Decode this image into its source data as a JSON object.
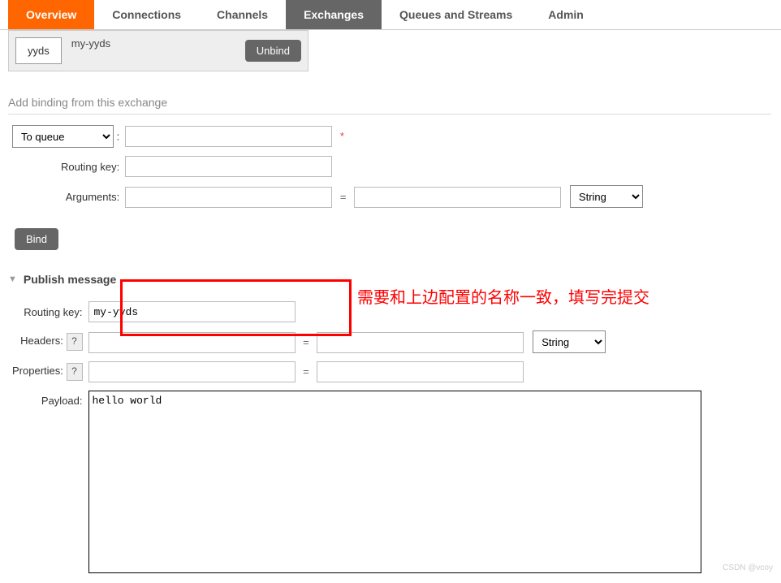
{
  "tabs": {
    "overview": "Overview",
    "connections": "Connections",
    "channels": "Channels",
    "exchanges": "Exchanges",
    "queues": "Queues and Streams",
    "admin": "Admin"
  },
  "binding": {
    "key": "yyds",
    "name": "my-yyds",
    "unbind": "Unbind"
  },
  "add_binding": {
    "title": "Add binding from this exchange",
    "dest_options": [
      "To queue"
    ],
    "dest_selected": "To queue",
    "routing_key_label": "Routing key:",
    "arguments_label": "Arguments:",
    "type_options": [
      "String"
    ],
    "type_selected": "String",
    "bind_btn": "Bind"
  },
  "publish": {
    "title": "Publish message",
    "routing_key_label": "Routing key:",
    "routing_key_value": "my-yyds",
    "headers_label": "Headers:",
    "header_type_selected": "String",
    "properties_label": "Properties:",
    "payload_label": "Payload:",
    "payload_value": "hello world",
    "help": "?"
  },
  "annotation": "需要和上边配置的名称一致，填写完提交",
  "watermark": "CSDN @vcoy"
}
